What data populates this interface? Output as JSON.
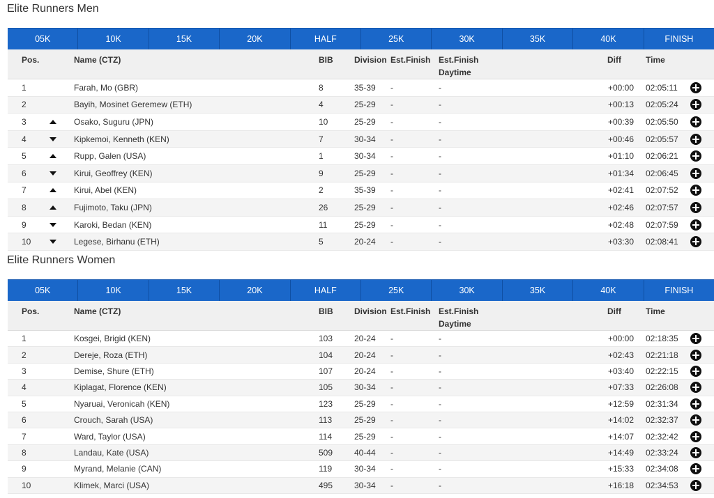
{
  "colors": {
    "tab_bar": "#1a67c9",
    "header_bg": "#f0f0f0",
    "row_alt": "#f4f4f4"
  },
  "sections": [
    {
      "title": "Elite Runners Men",
      "tabs": [
        "05K",
        "10K",
        "15K",
        "20K",
        "HALF",
        "25K",
        "30K",
        "35K",
        "40K",
        "FINISH"
      ],
      "headers": {
        "pos": "Pos.",
        "name": "Name (CTZ)",
        "bib": "BIB",
        "division": "Division",
        "est_finish": "Est.Finish",
        "est_finish_daytime": "Est.Finish\nDaytime",
        "diff": "Diff",
        "time": "Time"
      },
      "rows": [
        {
          "pos": "1",
          "trend": "",
          "name": "Farah, Mo (GBR)",
          "bib": "8",
          "division": "35-39",
          "est": "-",
          "day": "-",
          "diff": "+00:00",
          "time": "02:05:11"
        },
        {
          "pos": "2",
          "trend": "",
          "name": "Bayih, Mosinet Geremew (ETH)",
          "bib": "4",
          "division": "25-29",
          "est": "-",
          "day": "-",
          "diff": "+00:13",
          "time": "02:05:24"
        },
        {
          "pos": "3",
          "trend": "up",
          "name": "Osako, Suguru (JPN)",
          "bib": "10",
          "division": "25-29",
          "est": "-",
          "day": "-",
          "diff": "+00:39",
          "time": "02:05:50"
        },
        {
          "pos": "4",
          "trend": "down",
          "name": "Kipkemoi, Kenneth (KEN)",
          "bib": "7",
          "division": "30-34",
          "est": "-",
          "day": "-",
          "diff": "+00:46",
          "time": "02:05:57"
        },
        {
          "pos": "5",
          "trend": "up",
          "name": "Rupp, Galen (USA)",
          "bib": "1",
          "division": "30-34",
          "est": "-",
          "day": "-",
          "diff": "+01:10",
          "time": "02:06:21"
        },
        {
          "pos": "6",
          "trend": "down",
          "name": "Kirui, Geoffrey (KEN)",
          "bib": "9",
          "division": "25-29",
          "est": "-",
          "day": "-",
          "diff": "+01:34",
          "time": "02:06:45"
        },
        {
          "pos": "7",
          "trend": "up",
          "name": "Kirui, Abel (KEN)",
          "bib": "2",
          "division": "35-39",
          "est": "-",
          "day": "-",
          "diff": "+02:41",
          "time": "02:07:52"
        },
        {
          "pos": "8",
          "trend": "up",
          "name": "Fujimoto, Taku (JPN)",
          "bib": "26",
          "division": "25-29",
          "est": "-",
          "day": "-",
          "diff": "+02:46",
          "time": "02:07:57"
        },
        {
          "pos": "9",
          "trend": "down",
          "name": "Karoki, Bedan (KEN)",
          "bib": "11",
          "division": "25-29",
          "est": "-",
          "day": "-",
          "diff": "+02:48",
          "time": "02:07:59"
        },
        {
          "pos": "10",
          "trend": "down",
          "name": "Legese, Birhanu (ETH)",
          "bib": "5",
          "division": "20-24",
          "est": "-",
          "day": "-",
          "diff": "+03:30",
          "time": "02:08:41"
        }
      ]
    },
    {
      "title": "Elite Runners Women",
      "tabs": [
        "05K",
        "10K",
        "15K",
        "20K",
        "HALF",
        "25K",
        "30K",
        "35K",
        "40K",
        "FINISH"
      ],
      "headers": {
        "pos": "Pos.",
        "name": "Name (CTZ)",
        "bib": "BIB",
        "division": "Division",
        "est_finish": "Est.Finish",
        "est_finish_daytime": "Est.Finish\nDaytime",
        "diff": "Diff",
        "time": "Time"
      },
      "rows": [
        {
          "pos": "1",
          "trend": "",
          "name": "Kosgei, Brigid (KEN)",
          "bib": "103",
          "division": "20-24",
          "est": "-",
          "day": "-",
          "diff": "+00:00",
          "time": "02:18:35"
        },
        {
          "pos": "2",
          "trend": "",
          "name": "Dereje, Roza (ETH)",
          "bib": "104",
          "division": "20-24",
          "est": "-",
          "day": "-",
          "diff": "+02:43",
          "time": "02:21:18"
        },
        {
          "pos": "3",
          "trend": "",
          "name": "Demise, Shure (ETH)",
          "bib": "107",
          "division": "20-24",
          "est": "-",
          "day": "-",
          "diff": "+03:40",
          "time": "02:22:15"
        },
        {
          "pos": "4",
          "trend": "",
          "name": "Kiplagat, Florence (KEN)",
          "bib": "105",
          "division": "30-34",
          "est": "-",
          "day": "-",
          "diff": "+07:33",
          "time": "02:26:08"
        },
        {
          "pos": "5",
          "trend": "",
          "name": "Nyaruai, Veronicah (KEN)",
          "bib": "123",
          "division": "25-29",
          "est": "-",
          "day": "-",
          "diff": "+12:59",
          "time": "02:31:34"
        },
        {
          "pos": "6",
          "trend": "",
          "name": "Crouch, Sarah (USA)",
          "bib": "113",
          "division": "25-29",
          "est": "-",
          "day": "-",
          "diff": "+14:02",
          "time": "02:32:37"
        },
        {
          "pos": "7",
          "trend": "",
          "name": "Ward, Taylor (USA)",
          "bib": "114",
          "division": "25-29",
          "est": "-",
          "day": "-",
          "diff": "+14:07",
          "time": "02:32:42"
        },
        {
          "pos": "8",
          "trend": "",
          "name": "Landau, Kate (USA)",
          "bib": "509",
          "division": "40-44",
          "est": "-",
          "day": "-",
          "diff": "+14:49",
          "time": "02:33:24"
        },
        {
          "pos": "9",
          "trend": "",
          "name": "Myrand, Melanie (CAN)",
          "bib": "119",
          "division": "30-34",
          "est": "-",
          "day": "-",
          "diff": "+15:33",
          "time": "02:34:08"
        },
        {
          "pos": "10",
          "trend": "",
          "name": "Klimek, Marci (USA)",
          "bib": "495",
          "division": "30-34",
          "est": "-",
          "day": "-",
          "diff": "+16:18",
          "time": "02:34:53"
        }
      ]
    }
  ]
}
